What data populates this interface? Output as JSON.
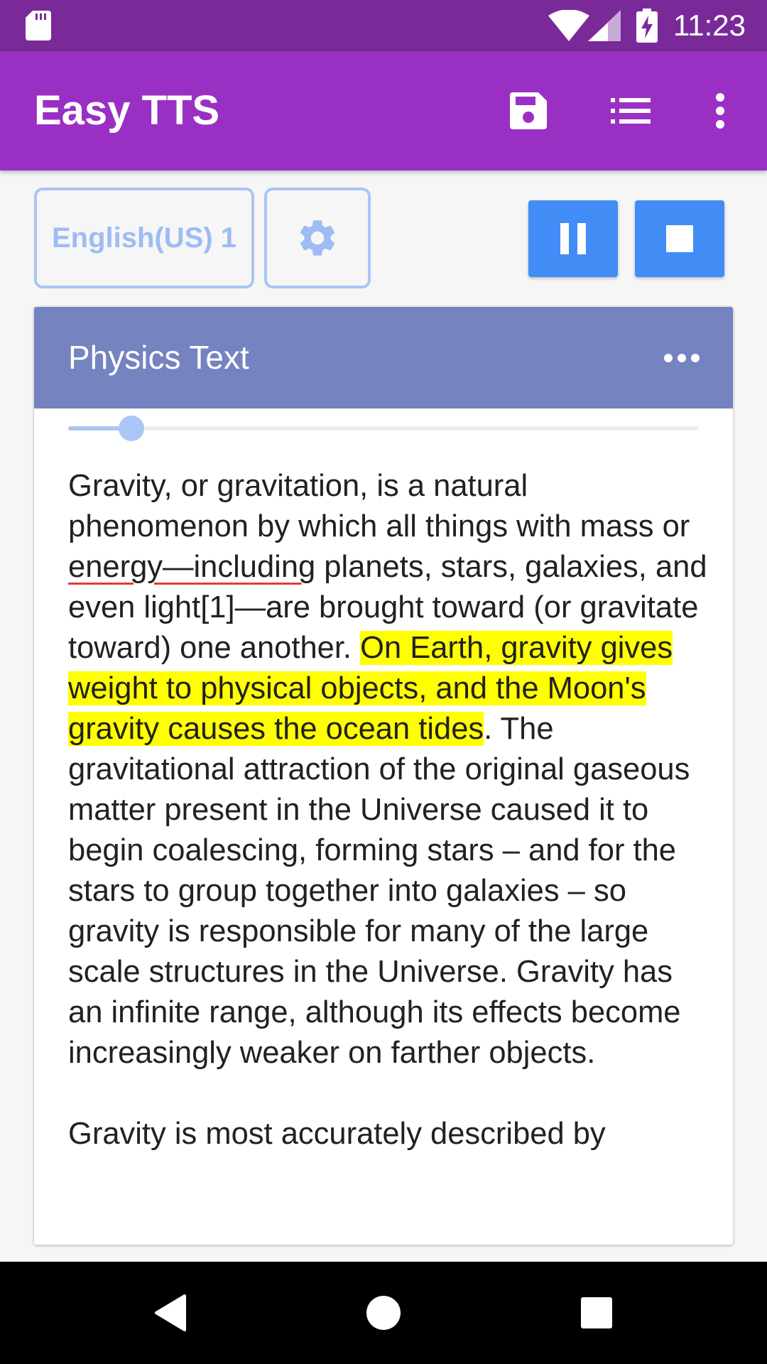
{
  "status_bar": {
    "time": "11:23"
  },
  "app_bar": {
    "title": "Easy TTS",
    "actions": [
      "save-icon",
      "list-icon",
      "more-vert-icon"
    ]
  },
  "controls": {
    "language_label": "English(US) 1",
    "settings_icon": "gear-icon",
    "pause_icon": "pause-icon",
    "stop_icon": "stop-icon"
  },
  "card": {
    "title": "Physics Text",
    "more_icon": "more-horiz-icon",
    "progress_fraction": 0.1,
    "paragraph1": {
      "a": "Gravity, or gravitation, is a natural phenomenon by which all things with mass or ",
      "misspelled": "energy—including",
      "b": " planets, stars, galaxies, and even light[1]—are brought toward (or gravitate toward) one another. ",
      "highlighted": "On Earth, gravity gives weight to physical objects, and the Moon's gravity causes the ocean tides",
      "c": ". The gravitational attraction of the original gaseous matter present in the Universe caused it to begin coalescing, forming stars – and for the stars to group together into galaxies – so gravity is responsible for many of the large scale structures in the Universe. Gravity has an infinite range, although its effects become increasingly weaker on farther objects."
    },
    "paragraph2": "Gravity is most accurately described by"
  },
  "colors": {
    "status_bar": "#7a2a98",
    "app_bar": "#9a30c3",
    "card_header": "#7583c0",
    "button_blue": "#428cf6",
    "outline_blue": "#a9c6f6",
    "highlight": "#ffff00"
  }
}
